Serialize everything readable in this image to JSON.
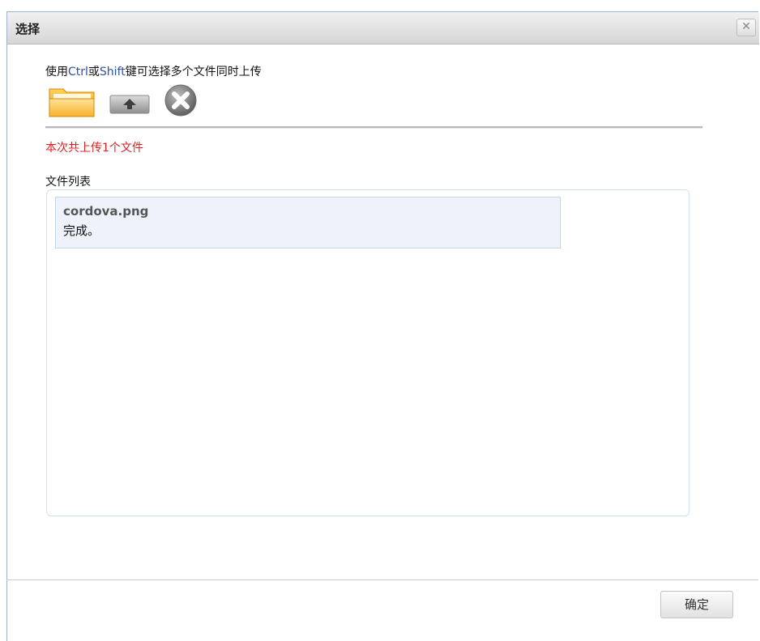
{
  "dialog": {
    "title": "选择",
    "close_symbol": "✕"
  },
  "upload": {
    "hint_prefix": "使用",
    "hint_key1": "Ctrl",
    "hint_mid": "或",
    "hint_key2": "Shift",
    "hint_suffix": "键可选择多个文件同时上传",
    "toolbar_icons": [
      "folder-icon",
      "upload-icon",
      "cancel-icon"
    ],
    "count_text": "本次共上传1个文件",
    "list_label": "文件列表",
    "files": [
      {
        "name": "cordova.png",
        "status": "完成。"
      }
    ]
  },
  "footer": {
    "ok_label": "确定"
  },
  "colors": {
    "accent_red": "#e02020",
    "key_blue": "#2e4fa8"
  }
}
